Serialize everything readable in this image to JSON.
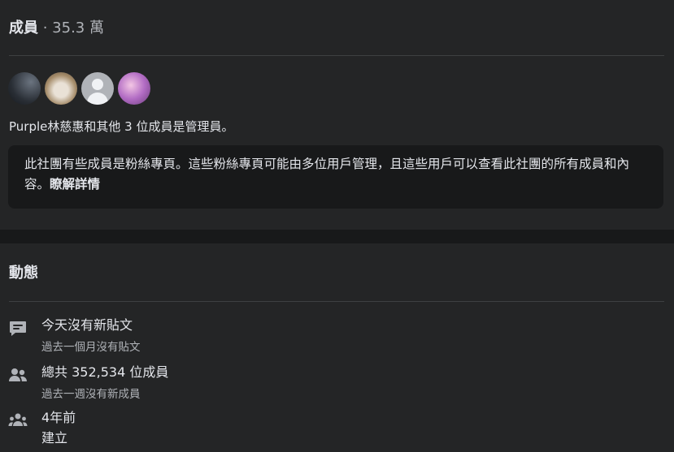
{
  "members": {
    "title": "成員",
    "count": " · 35.3 萬",
    "admins_text": "Purple林慈惠和其他 3 位成員是管理員。",
    "notice_text": "此社團有些成員是粉絲專頁。這些粉絲專頁可能由多位用戶管理，且這些用戶可以查看此社團的所有成員和內容。",
    "notice_link": "瞭解詳情"
  },
  "activity": {
    "title": "動態",
    "items": [
      {
        "icon": "chat-bubble-icon",
        "primary": "今天沒有新貼文",
        "secondary": "過去一個月沒有貼文"
      },
      {
        "icon": "members-icon",
        "primary": "總共 352,534 位成員",
        "secondary": "過去一週沒有新成員"
      },
      {
        "icon": "group-icon",
        "primary": "4年前",
        "secondary": "建立"
      }
    ]
  },
  "colors": {
    "background": "#18191a",
    "card": "#242526",
    "text_primary": "#e4e6eb",
    "text_secondary": "#b0b3b8",
    "icon": "#b0b3b8"
  }
}
